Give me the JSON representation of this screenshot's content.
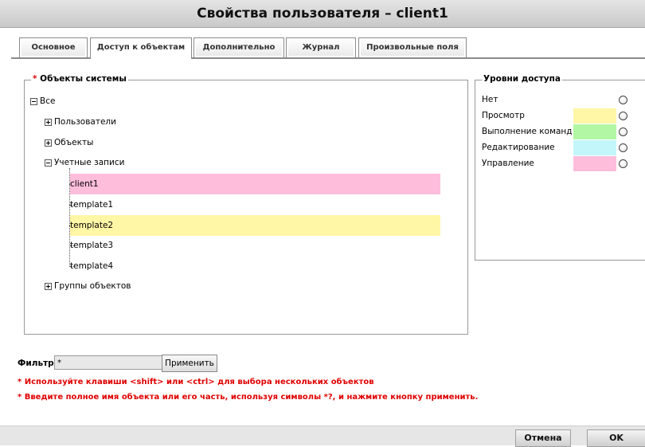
{
  "window": {
    "title": "Свойства пользователя – client1"
  },
  "tabs": [
    {
      "label": "Основное"
    },
    {
      "label": "Доступ к объектам",
      "active": true
    },
    {
      "label": "Дополнительно"
    },
    {
      "label": "Журнал"
    },
    {
      "label": "Произвольные поля"
    }
  ],
  "objects": {
    "required_mark": "*",
    "legend": " Объекты системы",
    "tree": {
      "root": "Все",
      "children": [
        {
          "label": "Пользователи",
          "expanded": false
        },
        {
          "label": "Объекты",
          "expanded": false
        },
        {
          "label": "Учетные записи",
          "expanded": true,
          "items": [
            {
              "label": "client1",
              "highlight": "#ffbddc"
            },
            {
              "label": "template1",
              "highlight": ""
            },
            {
              "label": "template2",
              "highlight": "#fff6a6"
            },
            {
              "label": "template3",
              "highlight": ""
            },
            {
              "label": "template4",
              "highlight": ""
            }
          ]
        },
        {
          "label": "Группы объектов",
          "expanded": false
        }
      ]
    }
  },
  "access": {
    "legend": "Уровни доступа",
    "levels": [
      {
        "label": "Нет",
        "color": ""
      },
      {
        "label": "Просмотр",
        "color": "#fff6a6"
      },
      {
        "label": "Выполнение команд",
        "color": "#b2f7a3"
      },
      {
        "label": "Редактирование",
        "color": "#c2f6fa"
      },
      {
        "label": "Управление",
        "color": "#ffbddc"
      }
    ]
  },
  "filter": {
    "label": "Фильтр",
    "value": "*",
    "apply_label": "Применить",
    "hint1": "* Используйте клавиши <shift> или <ctrl> для выбора нескольких объектов",
    "hint2": "* Введите полное имя объекта или его часть, используя символы *?, и нажмите кнопку применить."
  },
  "footer": {
    "cancel_label": "Отмена",
    "ok_label": "OK"
  }
}
